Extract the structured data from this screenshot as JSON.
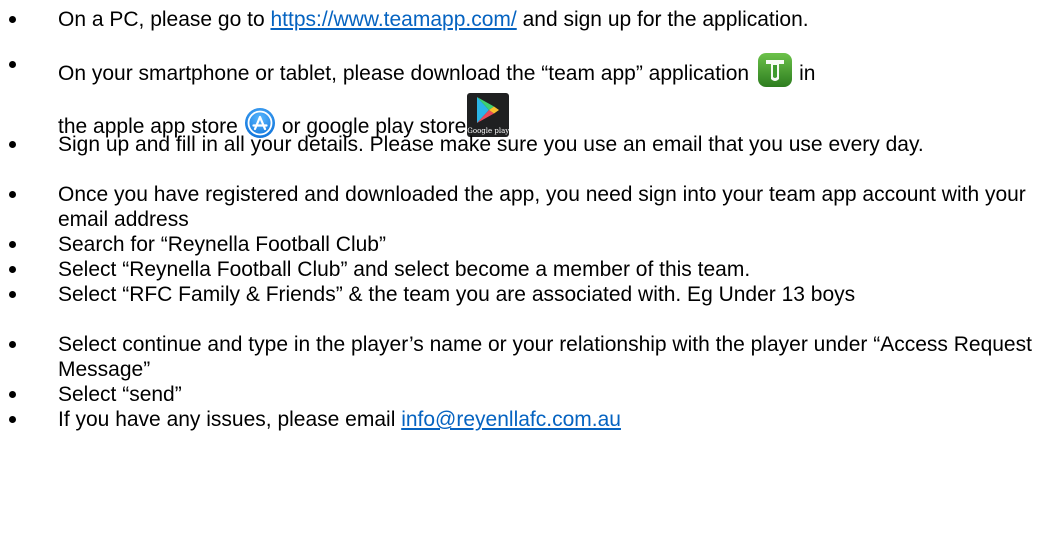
{
  "steps": [
    {
      "before": "On a PC, please go to ",
      "link": "https://www.teamapp.com/",
      "after": " and sign up for the application."
    },
    {
      "before": "On your smartphone or tablet, please download the “team app” application",
      "after_teamapp": "in",
      "line2_before": "the apple app store",
      "line2_middle": "or google play store",
      "icons": {
        "teamapp": "team-app-icon",
        "appstore": "app-store-icon",
        "googleplay": "google-play-icon"
      },
      "googleplay_caption": "Google play",
      "colors": {
        "teamapp_green": "#3e9a2e",
        "appstore_blue": "#1a8ff5",
        "googleplay_bg": "#1f2021"
      }
    },
    {
      "text": "Sign up and fill in all your details. Please make sure you use an email that you use every day."
    },
    {
      "text": "Once you have registered and downloaded the app, you need sign into your team app account with your email address"
    },
    {
      "text": "Search for “Reynella Football Club”"
    },
    {
      "text": "Select “Reynella Football Club” and select become a member of this team."
    },
    {
      "text": "Select “RFC Family & Friends” & the team you are associated with. Eg Under 13 boys"
    },
    {
      "text": "Select continue and type in the player’s name or your relationship with the player under “Access Request Message”"
    },
    {
      "text": "Select “send”"
    },
    {
      "before": "If you have any issues, please email ",
      "link": "info@reyenllafc.com.au"
    }
  ]
}
